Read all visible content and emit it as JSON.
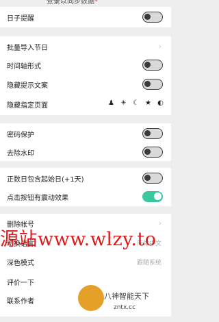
{
  "header": {
    "banner_text": "登录以同步数据",
    "banner_mark": "*"
  },
  "settings": {
    "daily_reminder": {
      "label": "日子提醒",
      "enabled": false
    },
    "batch_import": {
      "label": "批量导入节日"
    },
    "timeline": {
      "label": "时间轴形式",
      "enabled": false
    },
    "hide_tips": {
      "label": "隐藏提示文案",
      "enabled": false
    },
    "hide_pages": {
      "label": "隐藏指定页面",
      "icons": [
        "person-icon",
        "sun-icon",
        "moon-icon",
        "star-icon",
        "contrast-icon"
      ]
    },
    "password": {
      "label": "密码保护",
      "enabled": false
    },
    "watermark": {
      "label": "去除水印",
      "enabled": false
    },
    "countdown_start": {
      "label": "正数日包含起始日(+1天)",
      "enabled": false
    },
    "vibrate": {
      "label": "点击按钮有震动效果",
      "enabled": true
    },
    "delete_account": {
      "label": "删除帐号"
    },
    "language": {
      "label": "切换语言",
      "value": "简体中文"
    },
    "dark_mode": {
      "label": "深色模式",
      "value": "跟随系统"
    },
    "rate": {
      "label": "评价一下"
    },
    "contact": {
      "label": "联系作者"
    }
  },
  "overlay": {
    "watermark_text": "源站www.wlzy.to",
    "logo_line1": "八神智能天下",
    "logo_line2": "zntx.cc"
  },
  "colors": {
    "toggle_on": "#3cc7a3",
    "watermark": "#e0191a",
    "background": "#eeeeee"
  }
}
